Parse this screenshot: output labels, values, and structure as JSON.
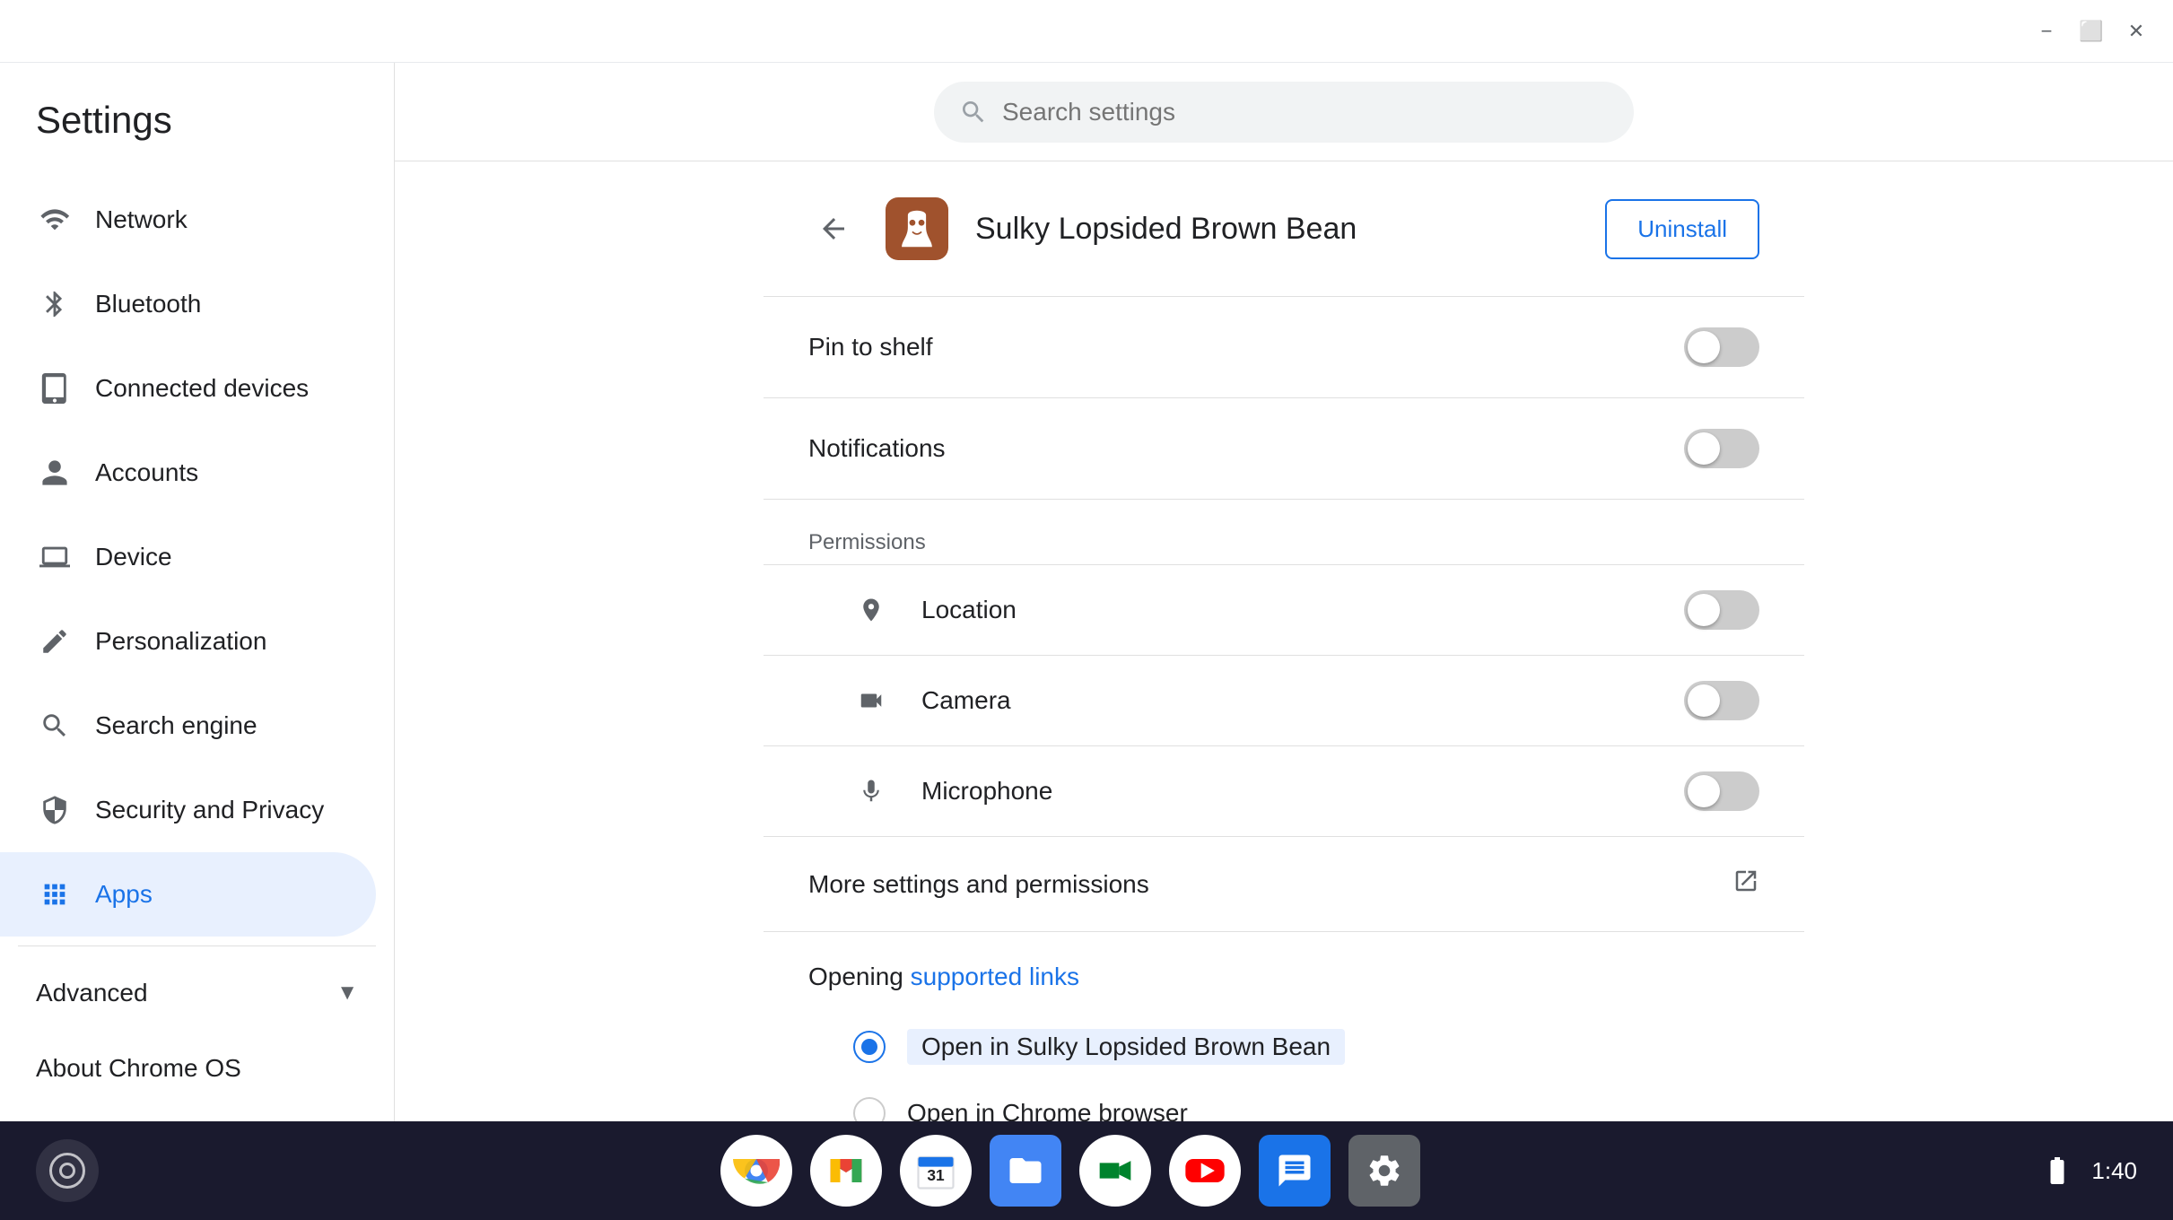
{
  "window": {
    "title": "Settings",
    "controls": {
      "minimize": "−",
      "maximize": "⬜",
      "close": "✕"
    }
  },
  "search": {
    "placeholder": "Search settings"
  },
  "sidebar": {
    "title": "Settings",
    "items": [
      {
        "id": "network",
        "label": "Network",
        "icon": "wifi"
      },
      {
        "id": "bluetooth",
        "label": "Bluetooth",
        "icon": "bluetooth"
      },
      {
        "id": "connected-devices",
        "label": "Connected devices",
        "icon": "tablet"
      },
      {
        "id": "accounts",
        "label": "Accounts",
        "icon": "person"
      },
      {
        "id": "device",
        "label": "Device",
        "icon": "laptop"
      },
      {
        "id": "personalization",
        "label": "Personalization",
        "icon": "pen"
      },
      {
        "id": "search-engine",
        "label": "Search engine",
        "icon": "search"
      },
      {
        "id": "security-privacy",
        "label": "Security and Privacy",
        "icon": "shield"
      },
      {
        "id": "apps",
        "label": "Apps",
        "icon": "grid",
        "active": true
      }
    ],
    "advanced_label": "Advanced",
    "about_label": "About Chrome OS"
  },
  "app_detail": {
    "app_name": "Sulky Lopsided Brown Bean",
    "uninstall_label": "Uninstall",
    "settings": [
      {
        "id": "pin-to-shelf",
        "label": "Pin to shelf",
        "enabled": false
      },
      {
        "id": "notifications",
        "label": "Notifications",
        "enabled": false
      }
    ],
    "permissions_header": "Permissions",
    "permissions": [
      {
        "id": "location",
        "label": "Location",
        "icon": "📍",
        "enabled": false
      },
      {
        "id": "camera",
        "label": "Camera",
        "icon": "📹",
        "enabled": false
      },
      {
        "id": "microphone",
        "label": "Microphone",
        "icon": "🎤",
        "enabled": false
      }
    ],
    "more_settings_label": "More settings and permissions",
    "opening_label": "Opening",
    "supported_links_label": "supported links",
    "radio_options": [
      {
        "id": "open-in-app",
        "label": "Open in Sulky Lopsided Brown Bean",
        "selected": true
      },
      {
        "id": "open-in-chrome",
        "label": "Open in Chrome browser",
        "selected": false
      }
    ]
  },
  "taskbar": {
    "time": "1:40",
    "apps": [
      {
        "id": "chrome",
        "label": "Chrome"
      },
      {
        "id": "gmail",
        "label": "Gmail"
      },
      {
        "id": "calendar",
        "label": "Calendar"
      },
      {
        "id": "files",
        "label": "Files"
      },
      {
        "id": "meet",
        "label": "Meet"
      },
      {
        "id": "youtube",
        "label": "YouTube"
      },
      {
        "id": "messages",
        "label": "Messages"
      },
      {
        "id": "settings",
        "label": "Settings"
      }
    ]
  }
}
